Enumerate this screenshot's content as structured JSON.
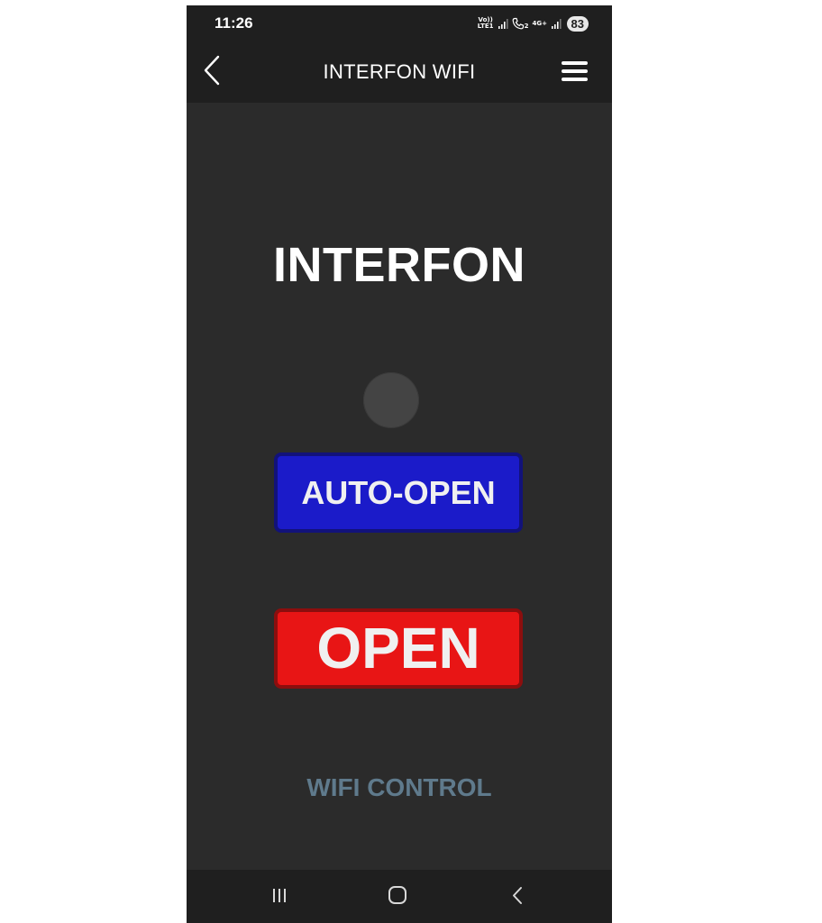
{
  "status_bar": {
    "time": "11:26",
    "volte_label": "Vo)) LTE1",
    "sim2_label": "2",
    "network_label": "4G+",
    "battery": "83"
  },
  "app_bar": {
    "title": "INTERFON WIFI",
    "back_icon": "chevron-left-icon",
    "menu_icon": "hamburger-menu-icon"
  },
  "main": {
    "heading": "INTERFON",
    "indicator_color": "#444444",
    "auto_open_label": "AUTO-OPEN",
    "auto_open_color": "#1b1bc9",
    "open_label": "OPEN",
    "open_color": "#e81515",
    "footer_label": "WIFI CONTROL"
  },
  "nav_bar": {
    "recents_icon": "recent-apps-icon",
    "home_icon": "home-icon",
    "back_icon": "back-icon"
  }
}
